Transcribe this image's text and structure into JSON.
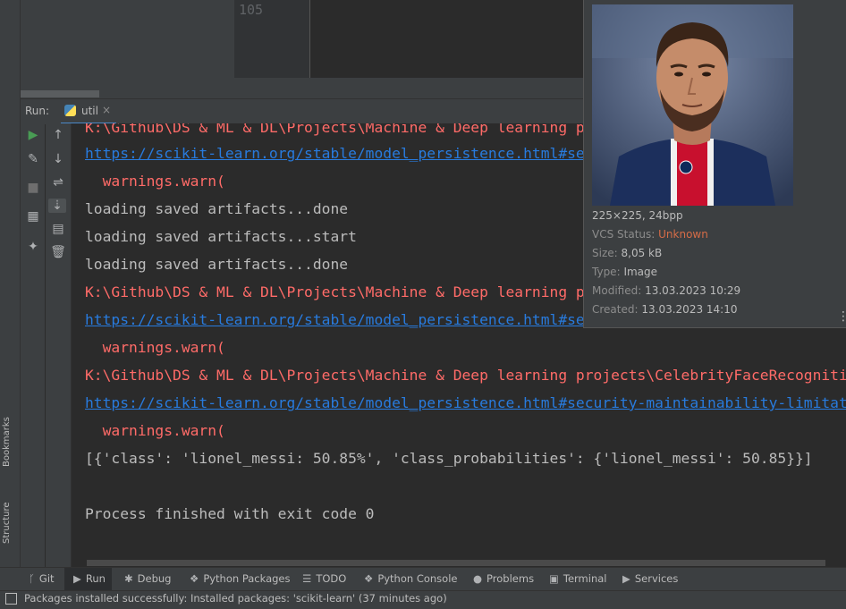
{
  "editor": {
    "line_number": "105"
  },
  "run_panel": {
    "label": "Run:",
    "tab_label": "util",
    "tab_close": "×"
  },
  "console_lines": [
    {
      "type": "err",
      "text": "K:\\Github\\DS & ML & DL\\Projects\\Machine & Deep learning projects\\CelebrityFaceRecognition\\server\\venv\\lib\\site-packages\\sklearn\\base.py:288: UserWarning: Trying to unpickle estimator"
    },
    {
      "type": "link",
      "text": "https://scikit-learn.org/stable/model_persistence.html#security-maintainability-limitations"
    },
    {
      "type": "err",
      "text": "  warnings.warn("
    },
    {
      "type": "norm",
      "text": "loading saved artifacts...done"
    },
    {
      "type": "norm",
      "text": "loading saved artifacts...start"
    },
    {
      "type": "norm",
      "text": "loading saved artifacts...done"
    },
    {
      "type": "err",
      "text": "K:\\Github\\DS & ML & DL\\Projects\\Machine & Deep learning projects\\CelebrityFaceRecognition\\server\\venv\\lib\\site-packages\\sklearn\\base.py:288: UserWarning: Trying to unpickle estimator"
    },
    {
      "type": "link",
      "text": "https://scikit-learn.org/stable/model_persistence.html#security-maintainability-limitations"
    },
    {
      "type": "err",
      "text": "  warnings.warn("
    },
    {
      "type": "err",
      "text": "K:\\Github\\DS & ML & DL\\Projects\\Machine & Deep learning projects\\CelebrityFaceRecognition\\server\\venv\\lib\\site-packages\\sklearn\\base.py:288: UserWarning: Trying to unpickle estimator"
    },
    {
      "type": "link",
      "text": "https://scikit-learn.org/stable/model_persistence.html#security-maintainability-limitations"
    },
    {
      "type": "err",
      "text": "  warnings.warn("
    },
    {
      "type": "norm",
      "text": "[{'class': 'lionel_messi: 50.85%', 'class_probabilities': {'lionel_messi': 50.85}}]"
    },
    {
      "type": "norm",
      "text": ""
    },
    {
      "type": "norm",
      "text": "Process finished with exit code 0"
    }
  ],
  "preview": {
    "dimensions": "225×225, 24bpp",
    "vcs_label": "VCS Status:",
    "vcs_value": "Unknown",
    "size_label": "Size:",
    "size_value": "8,05 kB",
    "type_label": "Type:",
    "type_value": "Image",
    "modified_label": "Modified:",
    "modified_value": "13.03.2023 10:29",
    "created_label": "Created:",
    "created_value": "13.03.2023 14:10",
    "menu_glyph": "⋮"
  },
  "side_labels": {
    "bookmarks": "Bookmarks",
    "structure": "Structure"
  },
  "tool_windows": [
    {
      "label": "Git",
      "icon": "ᚴ"
    },
    {
      "label": "Run",
      "icon": "▶"
    },
    {
      "label": "Debug",
      "icon": "✱"
    },
    {
      "label": "Python Packages",
      "icon": "❖"
    },
    {
      "label": "TODO",
      "icon": "☰"
    },
    {
      "label": "Python Console",
      "icon": "❖"
    },
    {
      "label": "Problems",
      "icon": "●"
    },
    {
      "label": "Terminal",
      "icon": "▣"
    },
    {
      "label": "Services",
      "icon": "▶"
    }
  ],
  "status": {
    "text": "Packages installed successfully: Installed packages: 'scikit-learn' (37 minutes ago)"
  },
  "colors": {
    "accent": "#4a88c7",
    "error": "#ff6b68",
    "link": "#287bde",
    "run_green": "#499c54"
  }
}
